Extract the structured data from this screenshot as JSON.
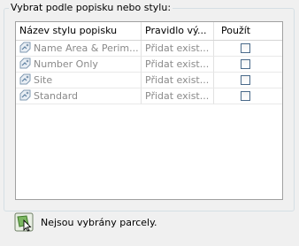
{
  "group": {
    "title": "Vybrat podle popisku nebo stylu:"
  },
  "table": {
    "headers": [
      "Název stylu popisku",
      "Pravidlo vý...",
      "Použít"
    ],
    "rows": [
      {
        "name": "Name Area & Perim...",
        "rule": "Přidat exist..."
      },
      {
        "name": "Number Only",
        "rule": "Přidat exist..."
      },
      {
        "name": "Site",
        "rule": "Přidat exist..."
      },
      {
        "name": "Standard",
        "rule": "Přidat exist..."
      }
    ]
  },
  "status": {
    "text": "Nejsou vybrány parcely."
  }
}
